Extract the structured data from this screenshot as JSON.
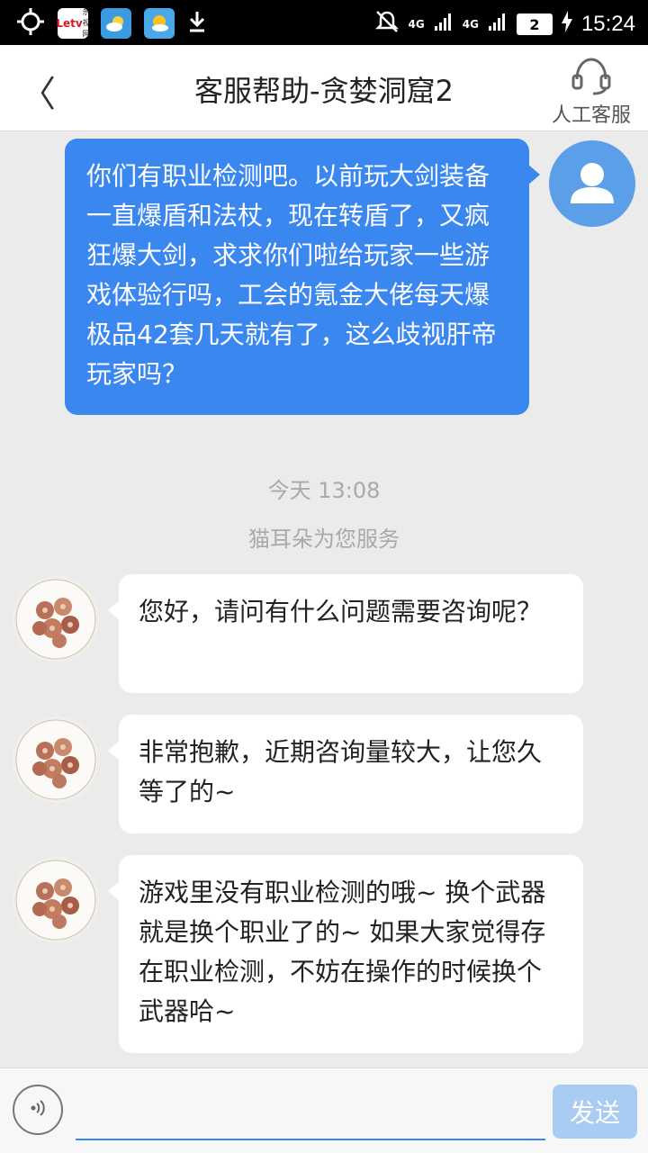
{
  "status_bar": {
    "app_icons": [
      "location-icon",
      "letv-icon",
      "weather-icon",
      "weather-icon",
      "download-icon"
    ],
    "letv_text": "Letv",
    "letv_subtext": "乐视网",
    "signal_1": "4G",
    "signal_2": "4G",
    "battery": "2",
    "time": "15:24"
  },
  "header": {
    "back_icon": "chevron-left-icon",
    "back_glyph": "〈",
    "title": "客服帮助-贪婪洞窟2",
    "agent_label": "人工客服"
  },
  "messages": {
    "user_1": "你们有职业检测吧。以前玩大剑装备一直爆盾和法杖，现在转盾了，又疯狂爆大剑，求求你们啦给玩家一些游戏体验行吗，工会的氪金大佬每天爆极品42套几天就有了，这么歧视肝帝玩家吗？",
    "timestamp": "今天 13:08",
    "service_notice": "猫耳朵为您服务",
    "cs_1": "您好，请问有什么问题需要咨询呢？",
    "cs_2": "非常抱歉，近期咨询量较大，让您久等了的~",
    "cs_3": "游戏里没有职业检测的哦~ 换个武器就是换个职业了的~ 如果大家觉得存在职业检测，不妨在操作的时候换个武器哈~"
  },
  "input_bar": {
    "placeholder": "",
    "send_label": "发送"
  },
  "colors": {
    "user_bubble": "#3a87f0",
    "background": "#ebebeb",
    "send_disabled": "#a9cdf2"
  }
}
